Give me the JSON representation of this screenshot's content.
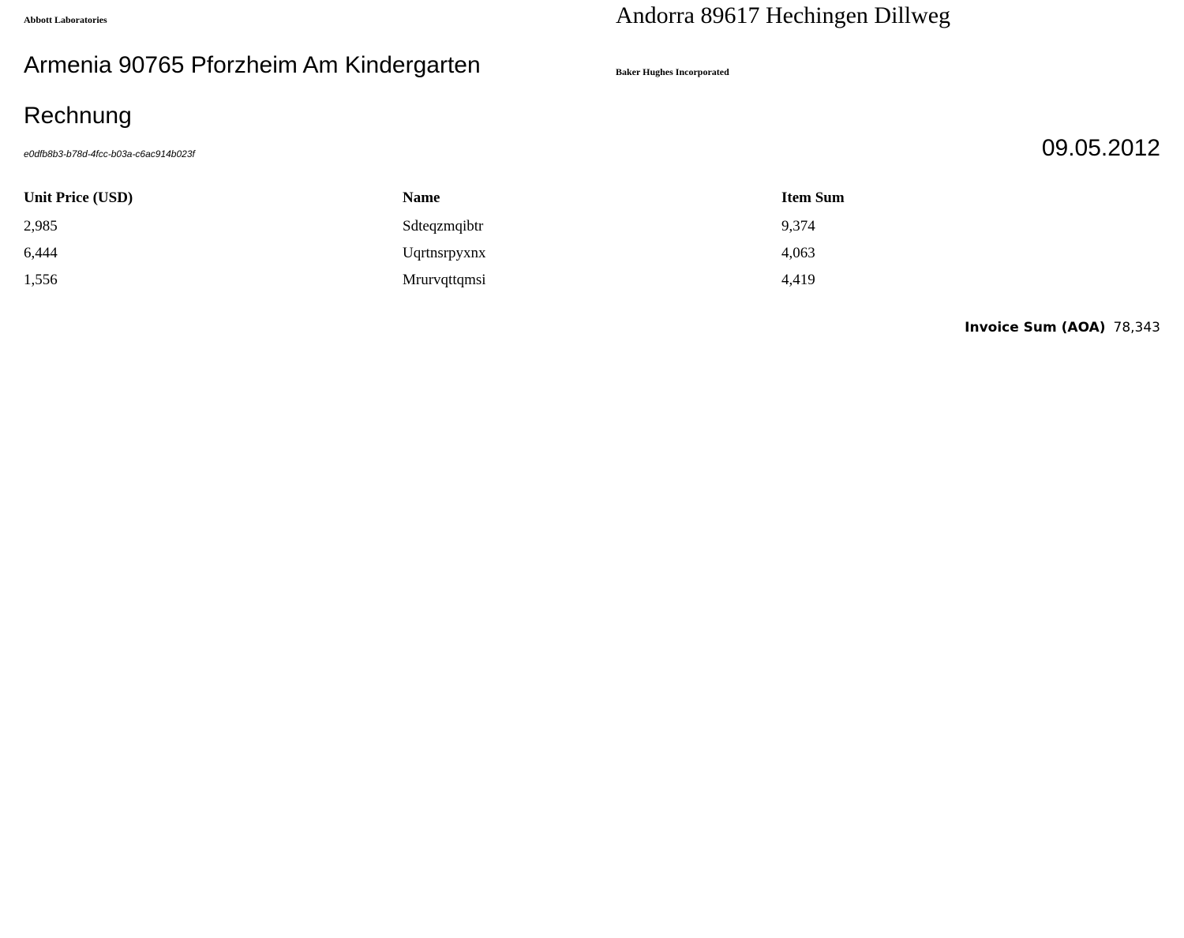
{
  "sender": {
    "company": "Abbott Laboratories",
    "address": "Armenia 90765 Pforzheim Am Kindergarten"
  },
  "recipient": {
    "address": "Andorra 89617 Hechingen Dillweg",
    "company": "Baker Hughes Incorporated"
  },
  "document": {
    "title": "Rechnung",
    "id": "e0dfb8b3-b78d-4fcc-b03a-c6ac914b023f",
    "date": "09.05.2012"
  },
  "table": {
    "headers": [
      "Unit Price (USD)",
      "Name",
      "Item Sum"
    ],
    "rows": [
      [
        "2,985",
        "Sdteqzmqibtr",
        "9,374"
      ],
      [
        "6,444",
        "Uqrtnsrpyxnx",
        "4,063"
      ],
      [
        "1,556",
        "Mrurvqttqmsi",
        "4,419"
      ]
    ]
  },
  "total": {
    "label": "Invoice Sum (AOA)",
    "value": "78,343"
  }
}
